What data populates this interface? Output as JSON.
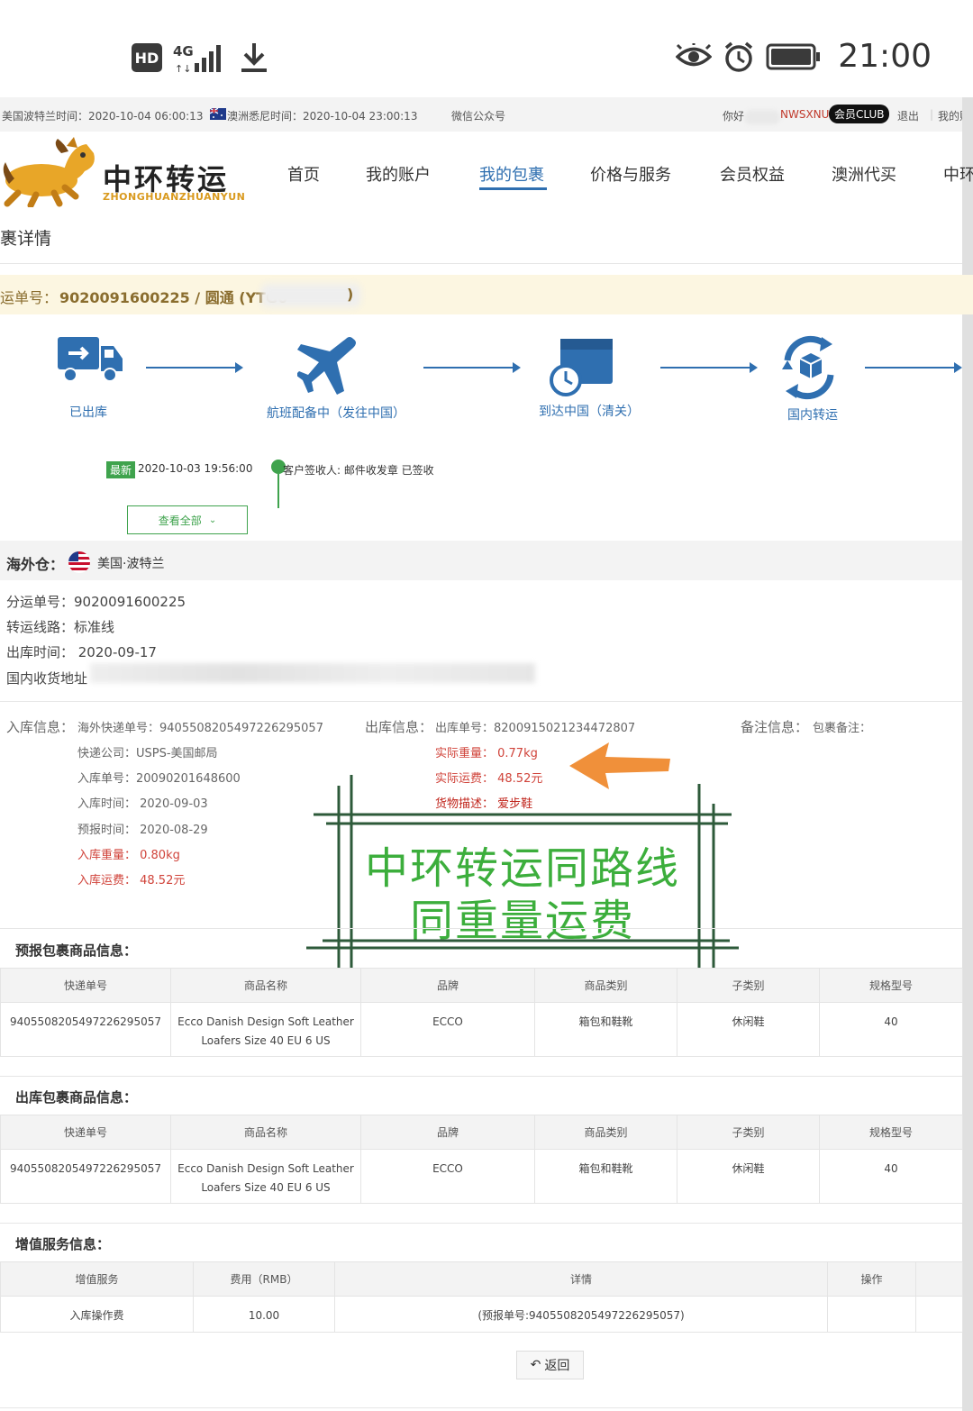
{
  "status_bar": {
    "hd_badge": "HD",
    "network_label": "4G",
    "time": "21:00",
    "icons": [
      "eye-icon",
      "alarm-icon",
      "battery-icon",
      "signal-icon",
      "download-icon"
    ]
  },
  "topbar": {
    "us_time": "美国波特兰时间：2020-10-04 06:00:13",
    "au_time": "澳洲悉尼时间：2020-10-04 23:00:13",
    "wechat": "微信公众号",
    "greeting": "你好",
    "username": "NWSXNU",
    "club": "会员CLUB",
    "logout": "退出",
    "my_account": "我的账户"
  },
  "header": {
    "logo_title": "中环转运",
    "logo_subtitle": "ZHONGHUANZHUANYUN",
    "nav": [
      "首页",
      "我的账户",
      "我的包裹",
      "价格与服务",
      "会员权益",
      "澳洲代买",
      "中环"
    ]
  },
  "page": {
    "heading": "裹详情",
    "waybill_label": "运单号：",
    "waybill_value": "9020091600225 / 圆通 (YTG0",
    "waybill_suffix": ")"
  },
  "steps": [
    "已出库",
    "航班配备中（发往中国）",
    "到达中国（清关）",
    "国内转运"
  ],
  "tracking": {
    "latest_label": "最新",
    "latest_time": "2020-10-03 19:56:00",
    "latest_text": "客户签收人: 邮件收发章 已签收",
    "view_all": "查看全部"
  },
  "warehouse": {
    "label": "海外仓：",
    "value": "美国·波特兰"
  },
  "details": {
    "sub_waybill": "分运单号：9020091600225",
    "route": "转运线路：标准线",
    "out_time": "出库时间： 2020-09-17",
    "address_label": "国内收货地址"
  },
  "inbound": {
    "section": "入库信息：",
    "tracking": "海外快递单号：9405508205497226295057",
    "courier": "快递公司：USPS-美国邮局",
    "in_no": "入库单号：20090201648600",
    "in_time": "入库时间： 2020-09-03",
    "pre_time": "预报时间： 2020-08-29",
    "in_weight": "入库重量： 0.80kg",
    "in_fee": "入库运费： 48.52元"
  },
  "outbound": {
    "section": "出库信息：",
    "out_no": "出库单号：8200915021234472807",
    "actual_weight": "实际重量： 0.77kg",
    "actual_fee": "实际运费： 48.52元",
    "goods_desc": "货物描述： 爱步鞋"
  },
  "remark": {
    "section": "备注信息：",
    "label": "包裹备注："
  },
  "annotation": {
    "line1": "中环转运同路线",
    "line2": "同重量运费"
  },
  "forecast_goods": {
    "title": "预报包裹商品信息：",
    "headers": [
      "快递单号",
      "商品名称",
      "品牌",
      "商品类别",
      "子类别",
      "规格型号"
    ],
    "row": [
      "9405508205497226295057",
      "Ecco Danish Design Soft Leather Loafers Size 40 EU 6 US",
      "ECCO",
      "箱包和鞋靴",
      "休闲鞋",
      "40"
    ]
  },
  "outbound_goods": {
    "title": "出库包裹商品信息：",
    "headers": [
      "快递单号",
      "商品名称",
      "品牌",
      "商品类别",
      "子类别",
      "规格型号"
    ],
    "row": [
      "9405508205497226295057",
      "Ecco Danish Design Soft Leather Loafers Size 40 EU 6 US",
      "ECCO",
      "箱包和鞋靴",
      "休闲鞋",
      "40"
    ]
  },
  "value_added": {
    "title": "增值服务信息：",
    "headers": [
      "增值服务",
      "费用（RMB）",
      "详情",
      "操作"
    ],
    "row": [
      "入库操作费",
      "10.00",
      "(预报单号:9405508205497226295057)",
      ""
    ]
  },
  "back_button": "返回",
  "colors": {
    "accent_blue": "#2f6fb0",
    "green": "#3fa34d",
    "red": "#d0433a",
    "orange": "#f0903a",
    "annotation_green": "#3cae3c"
  }
}
